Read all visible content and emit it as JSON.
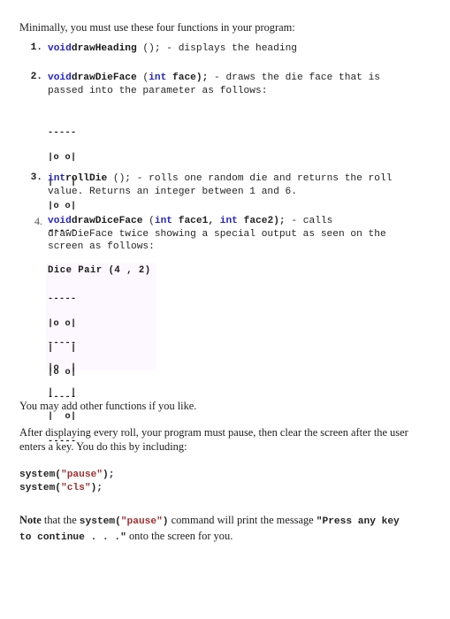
{
  "document": {
    "intro": "Minimally, you must use these four functions in your program:",
    "functions": [
      {
        "number": "1.",
        "keyword": "void",
        "name": "drawHeading",
        "signature_rest": " ();",
        "desc_line1": " - displays the heading",
        "desc_line2": ""
      },
      {
        "number": "2.",
        "keyword": "void",
        "name": "drawDieFace",
        "param_open": " (",
        "param_keyword": "int",
        "param_name": " face);",
        "desc_line1": " - draws the die face that is",
        "desc_line2": "passed into the parameter as follows:"
      },
      {
        "number": "3.",
        "keyword": "int",
        "name": "rollDie",
        "signature_rest": " ();",
        "desc_line1": " - rolls one random die and returns the roll",
        "desc_line2": "value. Returns an integer between 1 and 6."
      },
      {
        "number": "4.",
        "keyword": "void",
        "name": "drawDiceFace",
        "param_open": " (",
        "param_keyword1": "int",
        "param_mid": " face1, ",
        "param_keyword2": "int",
        "param_name": " face2);",
        "desc_line1": " - calls",
        "desc_line2": "drawDieFace twice showing a special output as seen on the",
        "desc_line3": "screen as follows:"
      }
    ],
    "die_sample": {
      "line1": "-----",
      "line2": "|o o|",
      "line3": "|   |",
      "line4": "|o o|",
      "line5": "-----"
    },
    "dice_pair": {
      "title": "Dice Pair (4 , 2)",
      "face1": {
        "line1": "-----",
        "line2": "|o o|",
        "line3": "|   |",
        "line4": "|o o|",
        "line5": "-----"
      },
      "face2": {
        "line1": "-----",
        "line2": "|o  |",
        "line3": "|   |",
        "line4": "|  o|",
        "line5": "-----"
      }
    },
    "para_other_funcs": "You may add other functions if you like.",
    "para_pause_line1": "After displaying every roll, your program must pause, then clear the screen after the user",
    "para_pause_line2": "enters a key. You do this by including:",
    "code_block": {
      "line1_fn": "system(",
      "line1_str": "\"pause\"",
      "line1_end": ");",
      "line2_fn": "system(",
      "line2_str": "\"cls\"",
      "line2_end": ");"
    },
    "note": {
      "label": "Note",
      "text_a": " that the ",
      "code_fn": "system(",
      "code_str": "\"pause\"",
      "code_end": ")",
      "text_b": " command will print the message ",
      "quote_line1": "\"Press any key",
      "quote_line2": "to continue . . .\"",
      "text_c": " onto the screen for you."
    }
  },
  "colors": {
    "keyword_blue": "#2424cc",
    "string_red": "#a03030",
    "output_box_bg": "#fdf7ff",
    "body_text": "#1c1c1c"
  }
}
